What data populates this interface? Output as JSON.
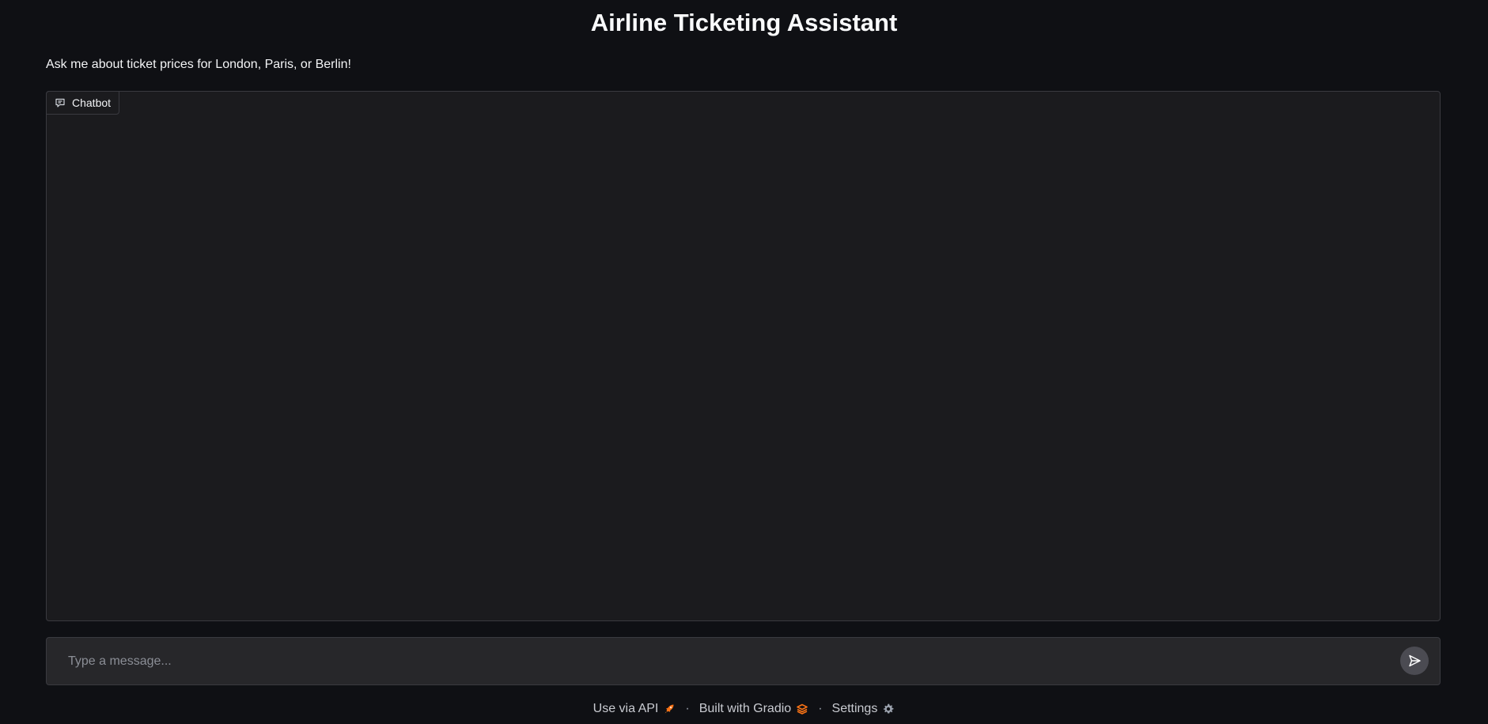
{
  "header": {
    "title": "Airline Ticketing Assistant",
    "description": "Ask me about ticket prices for London, Paris, or Berlin!"
  },
  "chatbot": {
    "label": "Chatbot",
    "icon": "chat-bubble-icon",
    "messages": []
  },
  "input": {
    "placeholder": "Type a message...",
    "value": "",
    "send_icon": "send-icon"
  },
  "footer": {
    "api_label": "Use via API",
    "api_icon": "rocket-icon",
    "separator": "·",
    "built_label": "Built with Gradio",
    "built_icon": "gradio-logo-icon",
    "settings_label": "Settings",
    "settings_icon": "gear-icon"
  },
  "colors": {
    "background": "#0f1014",
    "panel": "#1b1b1e",
    "input": "#27272a",
    "border": "#3a3a40",
    "accent_orange": "#f97316"
  }
}
